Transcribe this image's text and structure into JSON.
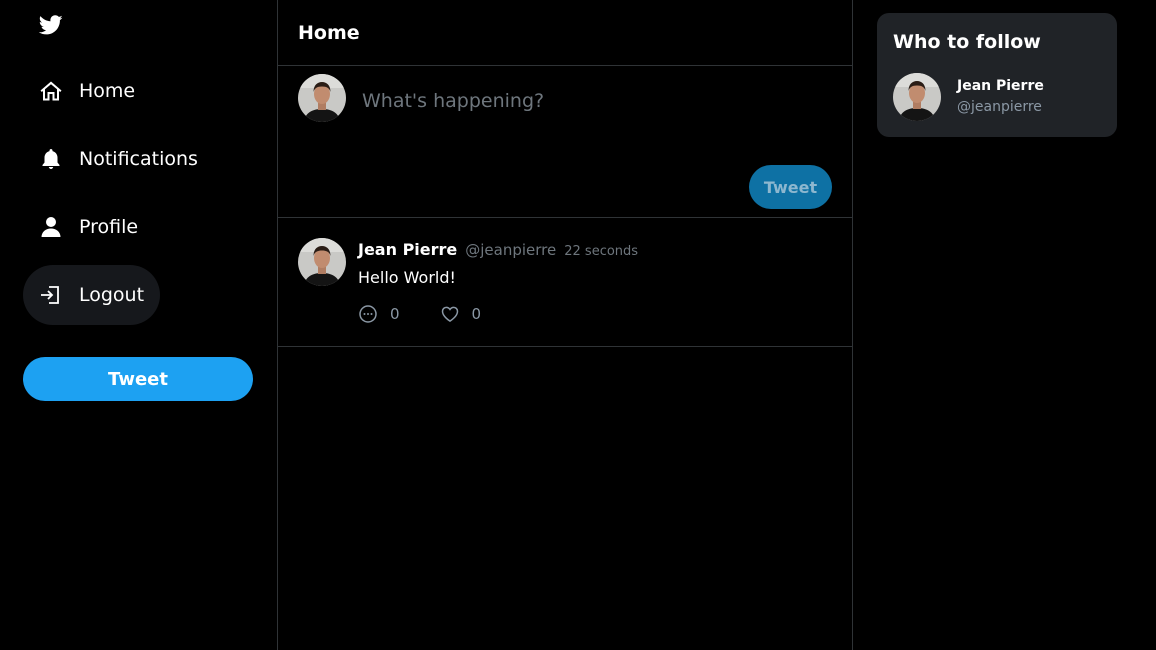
{
  "sidebar": {
    "logo": "twitter-bird-icon",
    "items": [
      {
        "label": "Home",
        "icon": "home-icon"
      },
      {
        "label": "Notifications",
        "icon": "bell-icon"
      },
      {
        "label": "Profile",
        "icon": "person-icon"
      },
      {
        "label": "Logout",
        "icon": "logout-icon"
      }
    ],
    "tweet_button": "Tweet"
  },
  "main": {
    "header_title": "Home",
    "composer": {
      "placeholder": "What's happening?",
      "button_label": "Tweet"
    },
    "tweets": [
      {
        "name": "Jean Pierre",
        "handle": "@jeanpierre",
        "time": "22 seconds",
        "text": "Hello World!",
        "replies": "0",
        "likes": "0"
      }
    ]
  },
  "who_to_follow": {
    "title": "Who to follow",
    "users": [
      {
        "name": "Jean Pierre",
        "handle": "@jeanpierre"
      }
    ]
  },
  "colors": {
    "accent": "#1da1f2",
    "accent_dim": "#0e71a4",
    "border": "#2f3336",
    "card_bg": "#202327",
    "muted_text": "#6e767d"
  }
}
